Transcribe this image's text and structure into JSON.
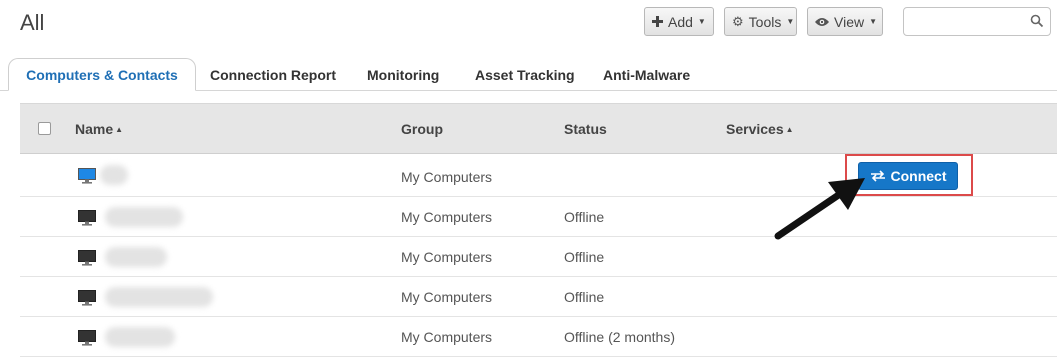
{
  "header": {
    "title": "All"
  },
  "toolbar": {
    "add": {
      "label": "Add",
      "icon": "plus-icon"
    },
    "tools": {
      "label": "Tools",
      "icon": "gear-icon"
    },
    "view": {
      "label": "View",
      "icon": "eye-icon"
    }
  },
  "search": {
    "value": "",
    "placeholder": "",
    "icon": "search-icon"
  },
  "tabs": [
    {
      "label": "Computers & Contacts",
      "active": true
    },
    {
      "label": "Connection Report",
      "active": false
    },
    {
      "label": "Monitoring",
      "active": false
    },
    {
      "label": "Asset Tracking",
      "active": false
    },
    {
      "label": "Anti-Malware",
      "active": false
    }
  ],
  "grid": {
    "columns": {
      "name": "Name",
      "group": "Group",
      "status": "Status",
      "services": "Services"
    },
    "rows": [
      {
        "group": "My Computers",
        "status": "",
        "monitor_color": "#1e88e5",
        "connect_label": "Connect"
      },
      {
        "group": "My Computers",
        "status": "Offline",
        "monitor_color": "#333333"
      },
      {
        "group": "My Computers",
        "status": "Offline",
        "monitor_color": "#333333"
      },
      {
        "group": "My Computers",
        "status": "Offline",
        "monitor_color": "#333333"
      },
      {
        "group": "My Computers",
        "status": "Offline (2 months)",
        "monitor_color": "#333333"
      }
    ]
  },
  "colors": {
    "accent": "#1677c8",
    "highlight": "#dc4a4a",
    "active_tab": "#1f6fb5"
  }
}
